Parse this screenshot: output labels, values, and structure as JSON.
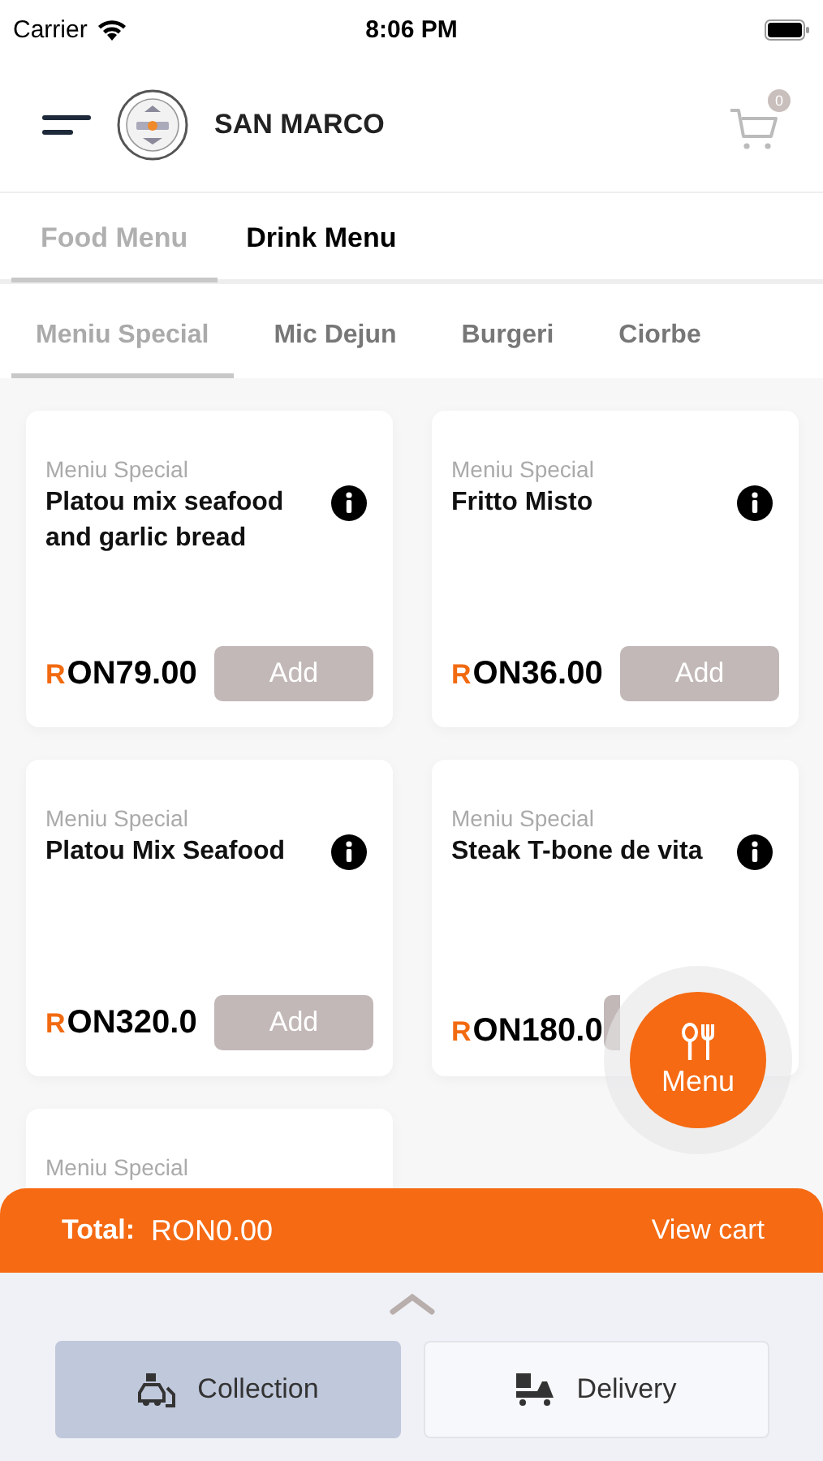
{
  "status_bar": {
    "carrier": "Carrier",
    "time": "8:06 PM"
  },
  "header": {
    "restaurant": "SAN MARCO",
    "cart_count": "0"
  },
  "menu_tabs": [
    {
      "label": "Food Menu",
      "selected": true
    },
    {
      "label": "Drink Menu",
      "selected": false
    }
  ],
  "category_tabs": [
    {
      "label": "Meniu Special",
      "selected": true
    },
    {
      "label": "Mic Dejun",
      "selected": false
    },
    {
      "label": "Burgeri",
      "selected": false
    },
    {
      "label": "Ciorbe",
      "selected": false
    }
  ],
  "items": [
    {
      "category": "Meniu Special",
      "name": "Platou mix seafood and garlic bread",
      "currency_initial": "R",
      "price": "ON79.00",
      "button": "Add"
    },
    {
      "category": "Meniu Special",
      "name": "Fritto Misto",
      "currency_initial": "R",
      "price": "ON36.00",
      "button": "Add"
    },
    {
      "category": "Meniu Special",
      "name": "Platou Mix Seafood",
      "currency_initial": "R",
      "price": "ON320.0",
      "button": "Add"
    },
    {
      "category": "Meniu Special",
      "name": "Steak T-bone de vita",
      "currency_initial": "R",
      "price": "ON180.0"
    },
    {
      "category": "Meniu Special"
    }
  ],
  "menu_button": "Menu",
  "cart_bar": {
    "total_label": "Total:",
    "total": "RON0.00",
    "action": "View cart"
  },
  "order_modes": [
    {
      "label": "Collection",
      "selected": true,
      "kind": "collection"
    },
    {
      "label": "Delivery",
      "selected": false,
      "kind": "delivery"
    }
  ]
}
